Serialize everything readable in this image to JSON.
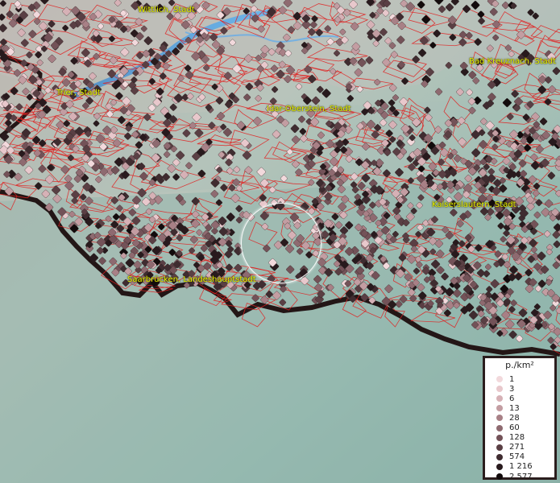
{
  "map": {
    "cities": [
      {
        "name": "Wittlich, Stadt"
      },
      {
        "name": "Bad Kreuznach, Stadt"
      },
      {
        "name": "Trier, Stadt"
      },
      {
        "name": "Idar-Oberstein, Stadt"
      },
      {
        "name": "Kaiserslautern, Stadt"
      },
      {
        "name": "Saarbrücken, Landeshauptstadt"
      }
    ],
    "legend": {
      "title": "p./km²",
      "items": [
        {
          "label": "1",
          "color": "#f2d9dc"
        },
        {
          "label": "3",
          "color": "#e8c8cc"
        },
        {
          "label": "6",
          "color": "#d6b1b6"
        },
        {
          "label": "13",
          "color": "#c39da2"
        },
        {
          "label": "28",
          "color": "#a88086"
        },
        {
          "label": "60",
          "color": "#8e6a70"
        },
        {
          "label": "128",
          "color": "#735258"
        },
        {
          "label": "271",
          "color": "#5a3f44"
        },
        {
          "label": "574",
          "color": "#3f2c30"
        },
        {
          "label": "1 216",
          "color": "#281a1d"
        },
        {
          "label": "2 577",
          "color": "#120b0c"
        }
      ]
    }
  }
}
